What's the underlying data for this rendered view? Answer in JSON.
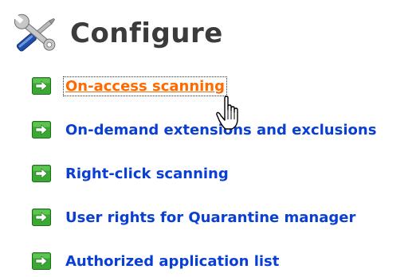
{
  "header": {
    "title": "Configure",
    "icon": "tools-icon"
  },
  "links": [
    {
      "label": "On-access scanning",
      "state": "hover"
    },
    {
      "label": "On-demand extensions and exclusions"
    },
    {
      "label": "Right-click scanning"
    },
    {
      "label": "User rights for Quarantine manager"
    },
    {
      "label": "Authorized application list"
    }
  ],
  "colors": {
    "link": "#0a3fd6",
    "link_hover": "#ff6a00",
    "arrow_green": "#3aa832",
    "title": "#3b3b3b"
  }
}
